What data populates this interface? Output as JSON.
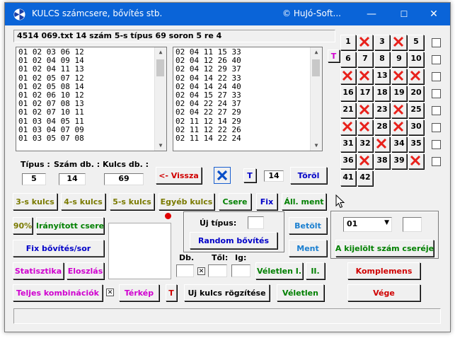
{
  "window": {
    "title": "KULCS számcsere, bővítés stb.",
    "brand": "© HuJó-Soft...",
    "minimize": "—",
    "maximize": "☐",
    "close": "✕"
  },
  "status": "4514  069.txt   14 szám  5-s típus   69 soron   5 re  4",
  "list_left": [
    "01 02 03 06 12",
    "01 02 04 09 14",
    "01 02 04 11 13",
    "01 02 05 07 12",
    "01 02 05 08 14",
    "01 02 06 10 12",
    "01 02 07 08 13",
    "01 02 07 10 11",
    "01 03 04 05 11",
    "01 03 04 07 09",
    "01 03 05 07 08"
  ],
  "list_right": [
    "02 04 11 15 33",
    "02 04 12 26 40",
    "02 04 12 29 37",
    "02 04 14 22 33",
    "02 04 14 24 40",
    "02 04 15 27 33",
    "02 04 22 24 37",
    "02 04 22 27 29",
    "02 11 12 14 29",
    "02 11 12 22 26",
    "02 11 14 22 24"
  ],
  "t_small": "T",
  "tipus": {
    "label": "Típus :",
    "value": "5"
  },
  "szam_db": {
    "label": "Szám db. :",
    "value": "14"
  },
  "kulcs_db": {
    "label": "Kulcs db. :",
    "value": "69"
  },
  "vissza": "<- Vissza",
  "t_btn": "T",
  "count14": "14",
  "torol": "Töröl",
  "row_buttons": {
    "kulcs3": "3-s kulcs",
    "kulcs4": "4-s kulcs",
    "kulcs5": "5-s kulcs",
    "egyeb": "Egyéb kulcs",
    "csere": "Csere",
    "fix": "Fix",
    "allment": "Áll. ment"
  },
  "pct": "90%",
  "iranyitott": "Irányított csere",
  "fix_bovites": "Fix bővítés/sor",
  "statisztika": "Statisztika",
  "eloszlas": "Eloszlás",
  "teljes": "Teljes kombinációk",
  "terkep": "Térkép",
  "t_red": "T",
  "uj_kulcs": "Uj kulcs rögzítése",
  "veletlen_btn": "Véletlen",
  "uj_tipus": {
    "label": "Új típus:",
    "value": ""
  },
  "random_bovites": "Random bővítés",
  "db_label": "Db.",
  "tol_label": "Től:",
  "ig_label": "Ig:",
  "veletlen_i": "Véletlen I.",
  "ii": "II.",
  "betolt": "Betölt",
  "ment": "Ment",
  "dropdown_value": "01",
  "kijelolt": "A kijelölt szám cseréje",
  "komplemens": "Komplemens",
  "vege": "Vége",
  "grid": [
    [
      "1",
      "x",
      "3",
      "x",
      "5"
    ],
    [
      "6",
      "7",
      "8",
      "9",
      "10"
    ],
    [
      "x",
      "x",
      "13",
      "x",
      "x"
    ],
    [
      "16",
      "17",
      "18",
      "19",
      "20"
    ],
    [
      "21",
      "x",
      "23",
      "x",
      "25"
    ],
    [
      "x",
      "x",
      "28",
      "x",
      "30"
    ],
    [
      "31",
      "32",
      "x",
      "34",
      "35"
    ],
    [
      "36",
      "x",
      "38",
      "39",
      "x"
    ],
    [
      "41",
      "42"
    ]
  ],
  "colors": {
    "title_bar": "#0a64d8",
    "olive": "#7a7a00",
    "green": "#008000",
    "blue": "#0000c8",
    "magenta": "#d000d0",
    "red": "#d00000",
    "x_red": "#e8201a"
  },
  "icons": {
    "app": "spiral-logo-icon",
    "checked": "x-checkbox-icon",
    "cursor": "mouse-pointer-icon"
  }
}
